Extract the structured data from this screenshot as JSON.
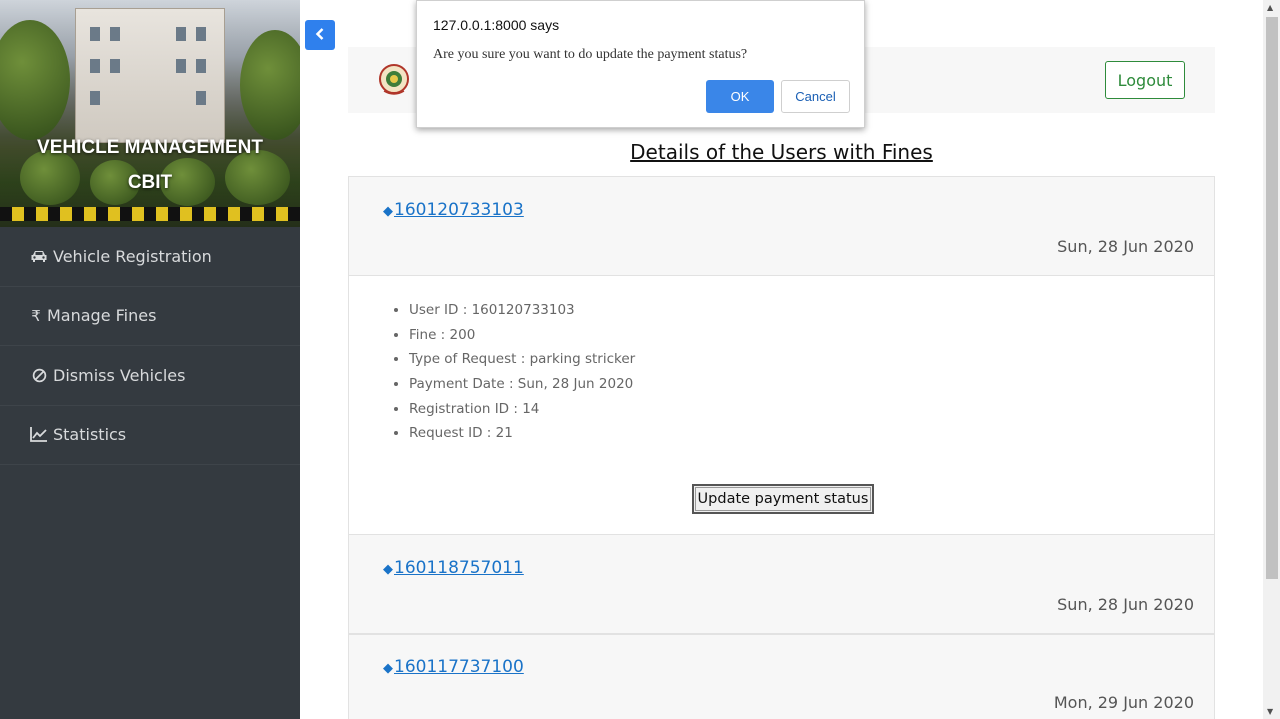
{
  "sidebar": {
    "title_line1": "VEHICLE MANAGEMENT",
    "title_line2": "CBIT",
    "items": [
      {
        "label": "Vehicle Registration",
        "icon": "car-icon"
      },
      {
        "label": "Manage Fines",
        "icon": "rupee-icon"
      },
      {
        "label": "Dismiss Vehicles",
        "icon": "ban-icon"
      },
      {
        "label": "Statistics",
        "icon": "line-chart-icon"
      }
    ]
  },
  "header": {
    "logout_label": "Logout"
  },
  "main": {
    "heading": "Details of the Users with Fines",
    "cards": [
      {
        "id": "160120733103",
        "date": "Sun, 28 Jun 2020",
        "details": [
          "User ID : 160120733103",
          "Fine : 200",
          "Type of Request : parking stricker",
          "Payment Date : Sun, 28 Jun 2020",
          "Registration ID : 14",
          "Request ID : 21"
        ],
        "update_label": "Update payment status"
      },
      {
        "id": "160118757011",
        "date": "Sun, 28 Jun 2020"
      },
      {
        "id": "160117737100",
        "date": "Mon, 29 Jun 2020"
      }
    ]
  },
  "dialog": {
    "origin": "127.0.0.1:8000 says",
    "message": "Are you sure you want to do update the payment status?",
    "ok_label": "OK",
    "cancel_label": "Cancel"
  },
  "colors": {
    "sidebar_bg": "#343a40",
    "accent_blue": "#2f80ed",
    "logout_green": "#2e8b3b",
    "link_blue": "#1a73c8"
  }
}
